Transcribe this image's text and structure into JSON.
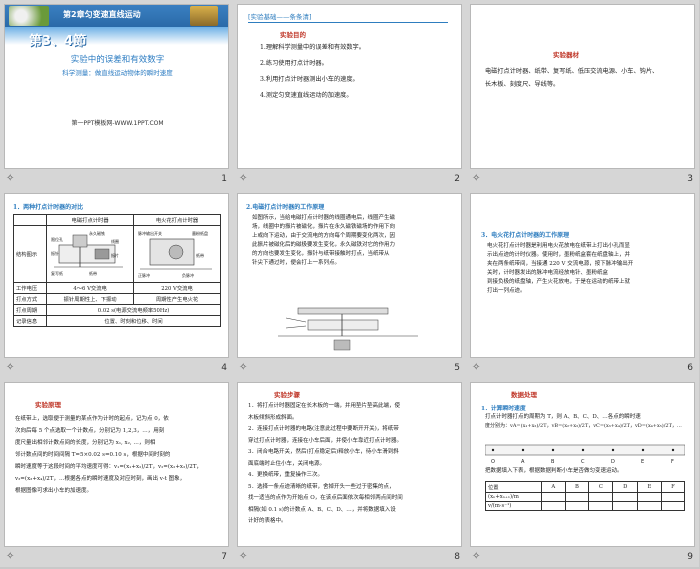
{
  "slides": [
    {
      "number": "1",
      "chapter": "第2章匀变速直线运动",
      "section": "第3、4節",
      "main_title": "实验中的误差和有效数字",
      "subtitle": "科学测量：做直线运动物体的瞬时速度",
      "footer": "第一PPT模板网-WWW.1PPT.COM"
    },
    {
      "number": "2",
      "tag": "[实验基础——条条清]",
      "heading": "实验目的",
      "items": [
        "1.理解科学测量中的误差和有效数字。",
        "2.练习使用打点计时器。",
        "3.利用打点计时器测出小车的速度。",
        "4.测定匀变速直线运动的加速度。"
      ]
    },
    {
      "number": "3",
      "heading": "实验器材",
      "lines": [
        "电磁打点计时器、纸带、复写纸、低压交流电源、小车、钩片、",
        "长木板、刻度尺、导线等。"
      ]
    },
    {
      "number": "4",
      "heading": "1．两种打点计时器的对比",
      "col1": "电磁打点计时器",
      "col2": "电火花打点计时器",
      "rows": [
        {
          "label": "结构图示",
          "a": "",
          "b": ""
        },
        {
          "label": "工作电压",
          "a": "4～6 V交流电",
          "b": "220 V交流电"
        },
        {
          "label": "打点方式",
          "a": "振针周期性上、下振动",
          "b": "周期性产生电火花"
        },
        {
          "label": "打点周期",
          "a": "0.02 s(电源交流电频率50Hz)",
          "b": ""
        },
        {
          "label": "记录信息",
          "a": "位置、时刻和位移、时间",
          "b": ""
        }
      ],
      "diagram_labels": [
        "限位孔",
        "永久磁铁",
        "线圈",
        "振针",
        "振片",
        "复写纸",
        "纸带",
        "脉冲输出开关",
        "墨粉纸盘",
        "纸带",
        "正脉冲",
        "负脉冲"
      ]
    },
    {
      "number": "5",
      "heading": "2.电磁打点计时器的工作原理",
      "lines": [
        "如图所示，当给电磁打点计时器的线圈通电后，线圈产生磁",
        "场，线圈中的振片被磁化，振片在永久磁铁磁场的作用下向",
        "上或向下运动，由于交流电的方向每个周期要变化两次，因",
        "此振片被磁化后的磁极要发生变化，永久磁铁对它的作用力",
        "的方向也要发生变化，振针与纸带接触时打点，当纸带从",
        "针尖下通过时，便会打上一系列点。"
      ]
    },
    {
      "number": "6",
      "heading": "3．电火花打点计时器的工作原理",
      "lines": [
        "电火花打点计时器是利用电火花放电在纸带上打出小孔而显",
        "示出点迹的计时仪器。使用时，墨粉纸盒套在纸盘轴上，并",
        "夹在两条纸带间，当接通 220 V 交流电源，按下脉冲输出开",
        "关时，计时器发出的脉冲电流经放电针、墨粉纸盒",
        "到接负极的纸盘轴，产生火花放电，于是在运动的纸带上就",
        "打出一列点迹。"
      ]
    },
    {
      "number": "7",
      "heading": "实验原理",
      "lines": [
        "在纸带上，选取便于测量的某点作为计时的起点，记为点 0，依",
        "次向后每 5 个点选取一个计数点，分别记为 1,2,3，…，用刻",
        "度尺量出相邻计数点间的长度，分别记为 x₁, x₂, …，则相",
        "邻计数点间的时间间隔 T=5×0.02 s=0.10 s，根据中间时刻的",
        "瞬时速度等于这段时间的平均速度可得：v₁=(x₁+x₂)/2T，v₂=(x₂+x₃)/2T，",
        "v₃=(x₃+x₄)/2T，…根据各点的瞬时速度及对应时刻，画出 v-t 图象，",
        "根据图像可求出小车的加速度。"
      ]
    },
    {
      "number": "8",
      "heading": "实验步骤",
      "lines": [
        "1．将打点计时器固定在长木板的一端，并用垫片垫高此端，使",
        "木板倾斜形成斜面。",
        "2．连接打点计时器的电路(注意此过程中要断开开关)，将纸带",
        "穿过打点计时器，连接在小车后面，并使小车靠近打点计时器。",
        "3．闭合电路开关，然后(打点稳定后)释放小车，待小车滑到斜",
        "面底端时止住小车，关闭电源。",
        "4．更换纸带，重复操作三次。",
        "5．选择一条点迹清晰的纸带，舍掉开头一些过于密集的点，",
        "找一适当的点作为开始点 O，在该点后面依次每相邻两点间时间",
        "相隔(如 0.1 s)的计数点 A、B、C、D、…，并将数据填入设",
        "计好的表格中。"
      ]
    },
    {
      "number": "9",
      "heading": "数据处理",
      "sub": "1．计算瞬时速度",
      "lines": [
        "打点计时器打点的周期为 T，则 A、B、C、D、…各点的瞬时速",
        "度分别为：vA=(x₁+x₂)/2T，vB=(x₂+x₃)/2T，vC=(x₃+x₄)/2T，vD=(x₄+x₅)/2T，…",
        "把数据填入下表，根据数据判断小车是否做匀变速运动。"
      ],
      "tape_labels": [
        "O",
        "A",
        "B",
        "C",
        "D",
        "E",
        "F"
      ],
      "table_header": [
        "位置",
        "A",
        "B",
        "C",
        "D",
        "E",
        "F"
      ],
      "table_rows": [
        "(xₙ+xₙ₊₁)/m",
        "v/(m·s⁻¹)"
      ]
    }
  ]
}
